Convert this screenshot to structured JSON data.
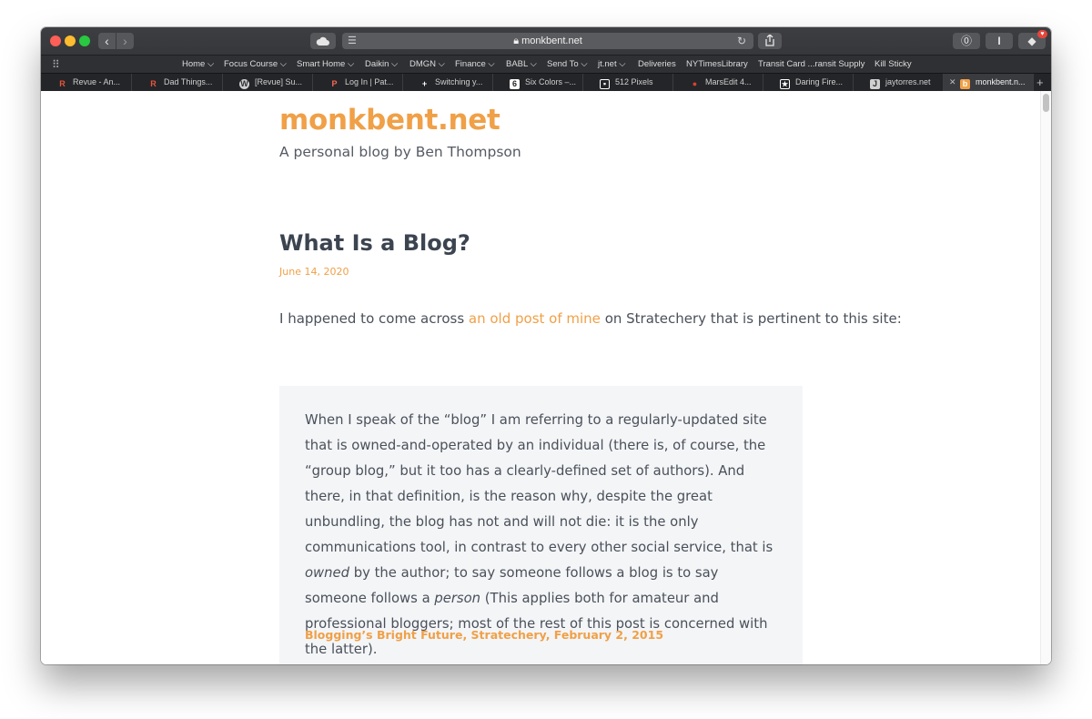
{
  "browser": {
    "address_url": "monkbent.net",
    "favorites": [
      {
        "label": "Home ⌵"
      },
      {
        "label": "Focus Course ⌵"
      },
      {
        "label": "Smart Home ⌵"
      },
      {
        "label": "Daikin ⌵"
      },
      {
        "label": "DMGN ⌵"
      },
      {
        "label": "Finance ⌵"
      },
      {
        "label": "BABL ⌵"
      },
      {
        "label": "Send To ⌵"
      },
      {
        "label": "jt.net ⌵"
      },
      {
        "label": "Deliveries"
      },
      {
        "label": "NYTimesLibrary"
      },
      {
        "label": "Transit Card ...ransit Supply"
      },
      {
        "label": "Kill Sticky"
      }
    ],
    "tabs": [
      {
        "label": "Revue - An...",
        "icon": "R",
        "color": "#e8553d"
      },
      {
        "label": "Dad Things...",
        "icon": "R",
        "color": "#e8553d"
      },
      {
        "label": "[Revue] Su...",
        "icon": "W",
        "color": "#d0d0d0"
      },
      {
        "label": "Log In | Pat...",
        "icon": "P",
        "color": "#f96854"
      },
      {
        "label": "Switching y...",
        "icon": "+",
        "color": "#ffffff"
      },
      {
        "label": "Six Colors –...",
        "icon": "6",
        "color": "#ffffff"
      },
      {
        "label": "512 Pixels",
        "icon": "■",
        "color": "#ffffff"
      },
      {
        "label": "MarsEdit 4...",
        "icon": "●",
        "color": "#d9412f"
      },
      {
        "label": "Daring Fire...",
        "icon": "★",
        "color": "#ffffff"
      },
      {
        "label": "jaytorres.net",
        "icon": "J",
        "color": "#d0d0d0"
      },
      {
        "label": "monkbent.n...",
        "icon": "b",
        "color": "#f0a047"
      }
    ]
  },
  "page": {
    "site_title": "monkbent.net",
    "tagline": "A personal blog by Ben Thompson",
    "post_title": "What Is a Blog?",
    "post_date": "June 14, 2020",
    "intro_before": "I happened to come across ",
    "intro_link": "an old post of mine",
    "intro_after": " on Stratechery that is pertinent to this site:",
    "quote_part1": "When I speak of the “blog” I am referring to a regularly-updated site that is owned-and-operated by an individual (there is, of course, the “group blog,” but it too has a clearly-defined set of authors). And there, in that definition, is the reason why, despite the great unbundling, the blog has not and will not die: it is the only communications tool, in contrast to every other social service, that is ",
    "quote_em1": "owned",
    "quote_part2": " by the author; to say someone follows a blog is to say someone follows a ",
    "quote_em2": "person",
    "quote_part3": " (This applies both for amateur and professional bloggers; most of the rest of this post is concerned with the latter).",
    "quote_citation": "Blogging’s Bright Future, Stratechery, February 2, 2015"
  },
  "colors": {
    "accent": "#f0a047",
    "text": "#4a505a",
    "quote_bg": "#f4f5f7",
    "chrome": "#36373b"
  }
}
